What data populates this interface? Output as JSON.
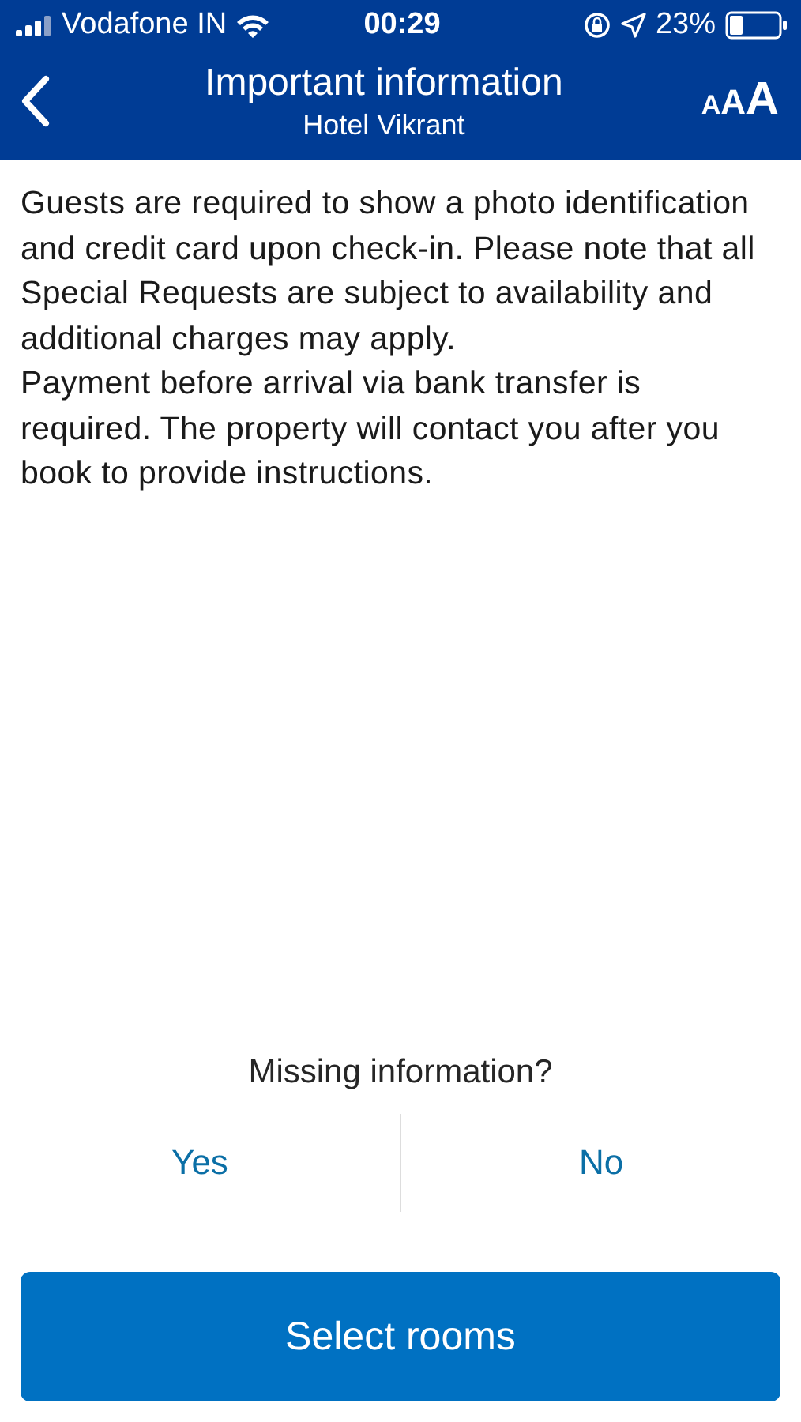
{
  "status_bar": {
    "carrier": "Vodafone IN",
    "time": "00:29",
    "battery": "23%"
  },
  "header": {
    "title": "Important information",
    "subtitle": "Hotel Vikrant",
    "text_size_letters": [
      "A",
      "A",
      "A"
    ]
  },
  "body": {
    "paragraphs": [
      "Guests are required to show a photo identification and credit card upon check-in. Please note that all Special Requests are subject to availability and additional charges may apply.",
      "Payment before arrival via bank transfer is required. The property will contact you after you book to provide instructions."
    ]
  },
  "feedback": {
    "question": "Missing information?",
    "answers": [
      "Yes",
      "No"
    ]
  },
  "primary_button": "Select rooms"
}
